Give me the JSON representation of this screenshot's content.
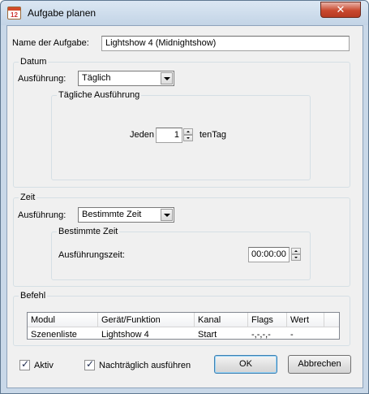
{
  "window": {
    "title": "Aufgabe planen",
    "close_symbol": "✕"
  },
  "task_name": {
    "label": "Name der Aufgabe:",
    "value": "Lightshow 4 (Midnightshow)"
  },
  "datum": {
    "group_title": "Datum",
    "execution_label": "Ausführung:",
    "execution_value": "Täglich",
    "daily": {
      "group_title": "Tägliche Ausführung",
      "prefix": "Jeden",
      "value": "1",
      "suffix": "tenTag"
    }
  },
  "zeit": {
    "group_title": "Zeit",
    "execution_label": "Ausführung:",
    "execution_value": "Bestimmte Zeit",
    "specific": {
      "group_title": "Bestimmte Zeit",
      "time_label": "Ausführungszeit:",
      "time_value": "00:00:00"
    }
  },
  "befehl": {
    "group_title": "Befehl",
    "columns": [
      "Modul",
      "Gerät/Funktion",
      "Kanal",
      "Flags",
      "Wert"
    ],
    "rows": [
      [
        "Szenenliste",
        "Lightshow 4",
        "Start",
        "-,-,-,-",
        "-"
      ]
    ]
  },
  "footer": {
    "active_label": "Aktiv",
    "active_checked": true,
    "late_label": "Nachträglich ausführen",
    "late_checked": true,
    "ok_label": "OK",
    "cancel_label": "Abbrechen"
  },
  "icons": {
    "app_icon": "calendar-icon",
    "app_icon_text": "12"
  }
}
